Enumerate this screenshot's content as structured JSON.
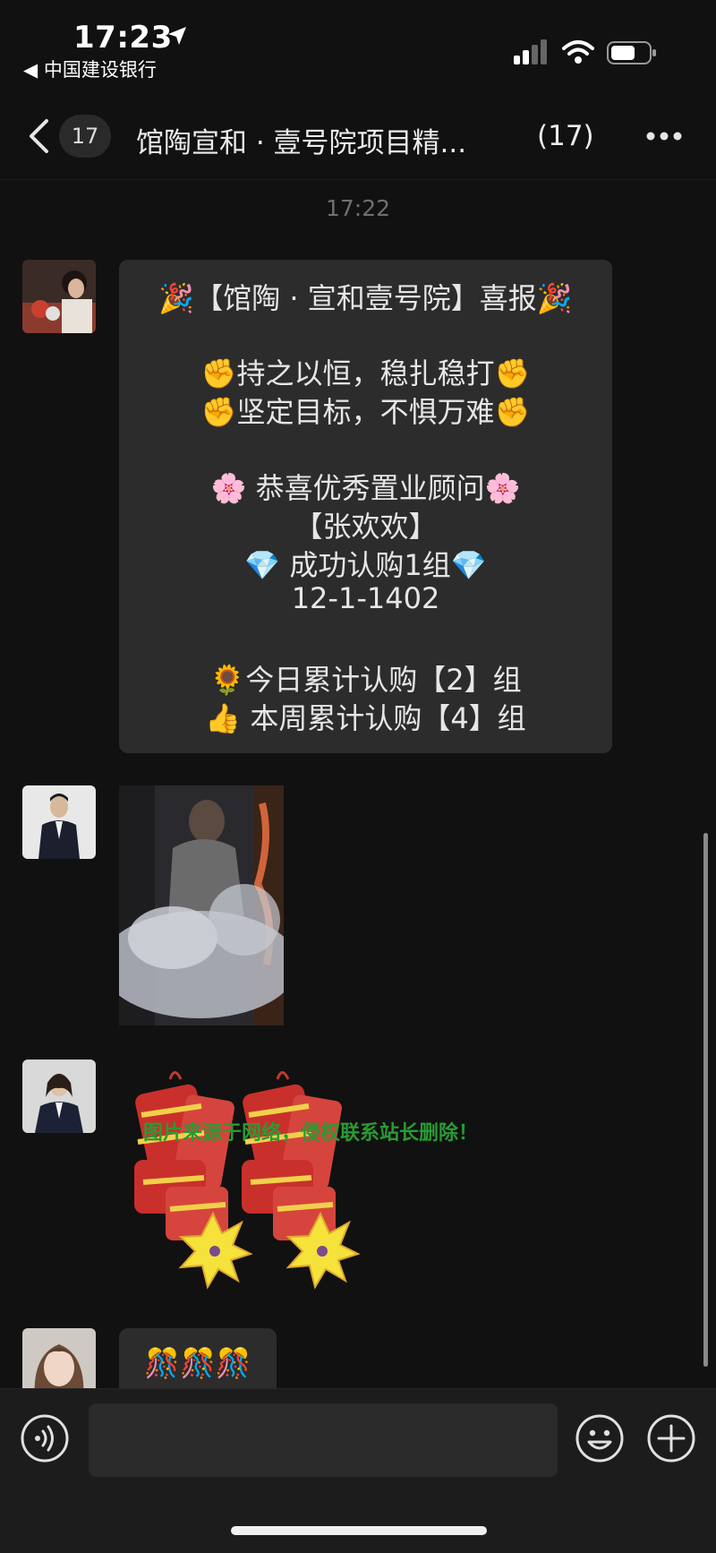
{
  "status_bar": {
    "time": "17:23",
    "back_app": "◀ 中国建设银行"
  },
  "header": {
    "unread_count": "17",
    "title": "馆陶宣和 · 壹号院项目精...",
    "member_count": "(17)"
  },
  "chat": {
    "timestamp": "17:22",
    "announcement_lines": [
      "🎉【馆陶 · 宣和壹号院】喜报🎉",
      "✊持之以恒，稳扎稳打✊",
      "✊坚定目标，不惧万难✊",
      "🌸 恭喜优秀置业顾问🌸",
      "【张欢欢】",
      "💎 成功认购1组💎",
      "12-1-1402",
      "🌻今日累计认购【2】组",
      "👍 本周累计认购【4】组"
    ],
    "watermark": "图片来源于网络，侵权联系站长删除！",
    "last_message": "🎊🎊🎊"
  },
  "colors": {
    "background": "#111111",
    "bubble": "#2c2c2c",
    "input_bar": "#1c1c1c",
    "watermark": "#2a9a33"
  },
  "icons": [
    "location-arrow-icon",
    "signal-icon",
    "wifi-icon",
    "battery-icon",
    "back-chevron-icon",
    "more-icon",
    "voice-icon",
    "emoji-icon",
    "plus-icon"
  ]
}
